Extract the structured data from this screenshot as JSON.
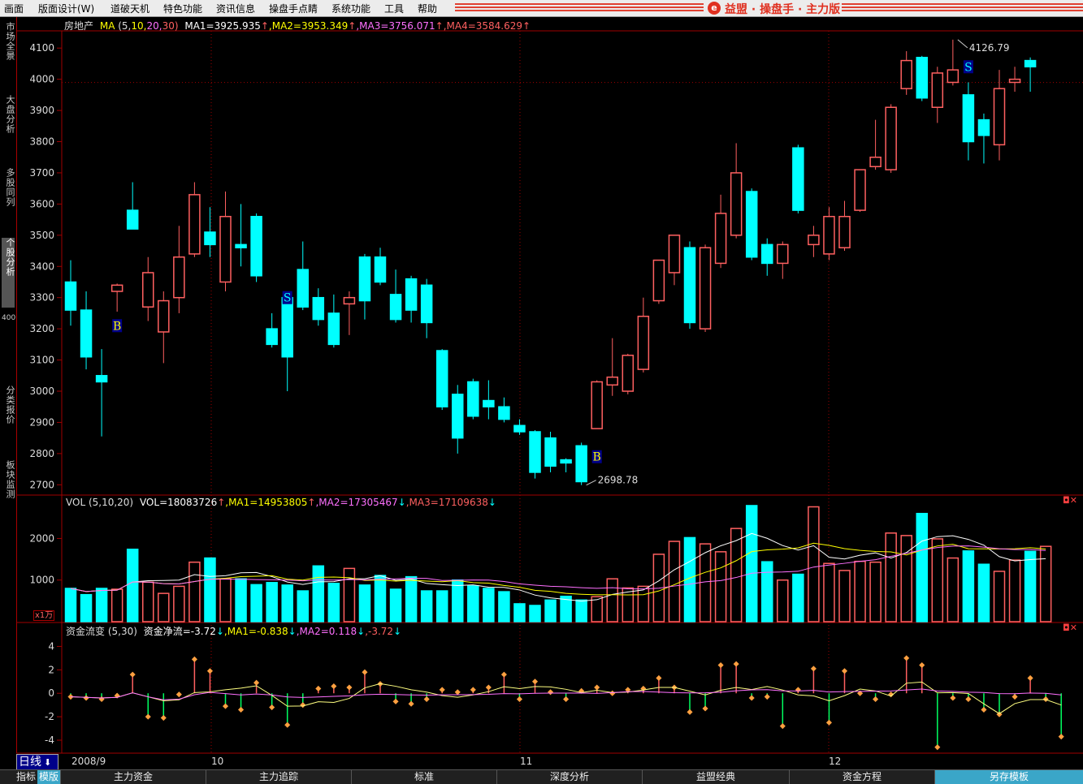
{
  "menu": [
    "画面",
    "版面设计(W)",
    "道破天机",
    "特色功能",
    "资讯信息",
    "操盘手点睛",
    "系统功能",
    "工具",
    "帮助"
  ],
  "brand": "益盟 · 操盘手 · 主力版",
  "brand_logo": "e",
  "left_tabs": [
    "市场全景",
    "大盘分析",
    "多股同列",
    "个股分析",
    "分类报价",
    "板块监测"
  ],
  "left_active_index": 3,
  "left_code": "400",
  "colors": {
    "up": "#ff6060",
    "down": "#00ffff",
    "ma_white": "#ffffff",
    "ma_yellow": "#ffff00",
    "ma_pink": "#ff70ff",
    "grid": "#a00000",
    "text_yellow": "#ffff00",
    "text_pink": "#ff70ff"
  },
  "price_header": {
    "name": "房地产",
    "ma_label": "MA",
    "params": [
      "(5,",
      "10,",
      "20,",
      "30)"
    ],
    "ma1": "MA1=3925.935",
    "ma2": ",MA2=3953.349",
    "ma3": ",MA3=3756.071",
    "ma4": ",MA4=3584.629"
  },
  "vol_header": {
    "label": "VOL (5,10,20)",
    "vol": "VOL=18083726",
    "ma1": ",MA1=14953805",
    "ma2": ",MA2=17305467",
    "ma3": ",MA3=17109638",
    "unit": "x1万"
  },
  "flow_header": {
    "label": "资金流变 (5,30)",
    "net": "资金净流=-3.72",
    "ma1": ",MA1=-0.838",
    "ma2": ",MA2=0.118",
    "last": ",-3.72"
  },
  "period": "日线",
  "period_icon": "arrow-down-icon",
  "bottom_tabs": [
    "指标",
    "模版",
    "主力资金",
    "主力追踪",
    "标准",
    "深度分析",
    "益盟经典",
    "资金方程",
    "另存模板"
  ],
  "date_labels": [
    "2008/9",
    "10",
    "11",
    "12"
  ],
  "chart_data": [
    {
      "type": "candlestick",
      "title": "房地产",
      "ylim": [
        2680,
        4150
      ],
      "yticks": [
        2700,
        2800,
        2900,
        3000,
        3100,
        3200,
        3300,
        3400,
        3500,
        3600,
        3700,
        3800,
        3900,
        4000,
        4100
      ],
      "ohlc": [
        [
          3350,
          3420,
          3210,
          3260
        ],
        [
          3260,
          3320,
          3070,
          3110
        ],
        [
          3050,
          3135,
          2855,
          3030
        ],
        [
          3320,
          3345,
          3255,
          3340
        ],
        [
          3580,
          3670,
          3520,
          3520
        ],
        [
          3270,
          3430,
          3225,
          3380
        ],
        [
          3190,
          3320,
          3090,
          3290
        ],
        [
          3300,
          3530,
          3250,
          3430
        ],
        [
          3440,
          3670,
          3430,
          3630
        ],
        [
          3510,
          3590,
          3430,
          3470
        ],
        [
          3350,
          3640,
          3320,
          3560
        ],
        [
          3470,
          3600,
          3400,
          3460
        ],
        [
          3560,
          3570,
          3350,
          3370
        ],
        [
          3200,
          3250,
          3140,
          3150
        ],
        [
          3300,
          3310,
          3000,
          3110
        ],
        [
          3390,
          3480,
          3260,
          3270
        ],
        [
          3300,
          3330,
          3210,
          3230
        ],
        [
          3250,
          3310,
          3140,
          3150
        ],
        [
          3280,
          3320,
          3180,
          3300
        ],
        [
          3430,
          3440,
          3230,
          3290
        ],
        [
          3430,
          3460,
          3340,
          3350
        ],
        [
          3310,
          3390,
          3220,
          3230
        ],
        [
          3360,
          3370,
          3220,
          3260
        ],
        [
          3340,
          3360,
          3170,
          3220
        ],
        [
          3130,
          3135,
          2940,
          2950
        ],
        [
          2990,
          3020,
          2800,
          2850
        ],
        [
          3030,
          3040,
          2910,
          2920
        ],
        [
          2970,
          3035,
          2910,
          2950
        ],
        [
          2950,
          2980,
          2900,
          2910
        ],
        [
          2890,
          2910,
          2860,
          2870
        ],
        [
          2870,
          2875,
          2720,
          2740
        ],
        [
          2850,
          2870,
          2740,
          2760
        ],
        [
          2780,
          2785,
          2740,
          2770
        ],
        [
          2825,
          2835,
          2699,
          2710
        ],
        [
          2880,
          3035,
          2880,
          3030
        ],
        [
          3020,
          3170,
          2985,
          3045
        ],
        [
          3000,
          3120,
          2990,
          3115
        ],
        [
          3070,
          3300,
          3060,
          3240
        ],
        [
          3290,
          3410,
          3280,
          3420
        ],
        [
          3380,
          3500,
          3340,
          3500
        ],
        [
          3460,
          3480,
          3200,
          3220
        ],
        [
          3200,
          3470,
          3190,
          3460
        ],
        [
          3410,
          3630,
          3395,
          3570
        ],
        [
          3500,
          3795,
          3490,
          3700
        ],
        [
          3640,
          3650,
          3420,
          3430
        ],
        [
          3470,
          3490,
          3370,
          3410
        ],
        [
          3410,
          3480,
          3360,
          3470
        ],
        [
          3780,
          3790,
          3570,
          3580
        ],
        [
          3470,
          3530,
          3430,
          3500
        ],
        [
          3440,
          3590,
          3420,
          3560
        ],
        [
          3460,
          3610,
          3450,
          3560
        ],
        [
          3580,
          3700,
          3575,
          3710
        ],
        [
          3720,
          3870,
          3710,
          3750
        ],
        [
          3710,
          3920,
          3700,
          3910
        ],
        [
          3970,
          4090,
          3950,
          4060
        ],
        [
          4070,
          4075,
          3930,
          3940
        ],
        [
          3910,
          4040,
          3860,
          4020
        ],
        [
          3990,
          4127,
          3980,
          4030
        ],
        [
          3950,
          3990,
          3740,
          3800
        ],
        [
          3870,
          3890,
          3730,
          3820
        ],
        [
          3790,
          4030,
          3740,
          3970
        ],
        [
          3990,
          4040,
          3960,
          4000
        ],
        [
          4060,
          4070,
          3960,
          4040
        ]
      ],
      "signals": [
        {
          "index": 3,
          "label": "B",
          "price": 3210
        },
        {
          "index": 14,
          "label": "S",
          "price": 3300
        },
        {
          "index": 34,
          "label": "B",
          "price": 2790
        },
        {
          "index": 58,
          "label": "S",
          "price": 4040
        }
      ],
      "annotations": [
        {
          "label": "4126.79",
          "index": 57,
          "price": 4127
        },
        {
          "label": "2698.78",
          "index": 33,
          "price": 2699
        }
      ]
    },
    {
      "type": "bar",
      "title": "VOL",
      "ylim": [
        0,
        2750
      ],
      "yticks": [
        1000,
        2000
      ],
      "values": [
        800,
        650,
        800,
        780,
        1740,
        950,
        680,
        850,
        1430,
        1530,
        1030,
        1030,
        890,
        940,
        880,
        740,
        1340,
        920,
        1280,
        880,
        1110,
        780,
        1080,
        740,
        740,
        1000,
        860,
        800,
        720,
        430,
        390,
        520,
        610,
        520,
        600,
        1030,
        810,
        850,
        1620,
        1930,
        2020,
        1870,
        1680,
        2240,
        2790,
        1440,
        1000,
        1140,
        2760,
        1400,
        1230,
        1450,
        1430,
        2130,
        2070,
        2600,
        1990,
        1530,
        1700,
        1380,
        1210,
        1480,
        1690,
        1810
      ]
    },
    {
      "type": "line",
      "title": "资金流变",
      "ylim": [
        -4.9,
        5
      ],
      "yticks": [
        -4,
        -2,
        0,
        2,
        4
      ],
      "values": [
        -0.3,
        -0.4,
        -0.5,
        -0.2,
        1.6,
        -2.0,
        -2.1,
        -0.1,
        2.9,
        1.9,
        -1.1,
        -1.4,
        0.9,
        -1.2,
        -2.7,
        -1.0,
        0.4,
        0.6,
        0.5,
        1.8,
        0.8,
        -0.7,
        -0.9,
        -0.5,
        0.3,
        0.1,
        0.3,
        0.5,
        1.6,
        -0.5,
        1.0,
        0.1,
        -0.5,
        0.2,
        0.5,
        0.0,
        0.3,
        0.4,
        1.3,
        0.5,
        -1.6,
        -1.3,
        2.4,
        2.5,
        -0.4,
        -0.3,
        -2.8,
        0.3,
        2.1,
        -2.5,
        1.9,
        0.0,
        -0.5,
        -0.1,
        3.0,
        2.4,
        -4.6,
        -0.4,
        -0.5,
        -1.4,
        -1.8,
        -0.3,
        1.3,
        -0.5,
        -3.7
      ]
    }
  ]
}
